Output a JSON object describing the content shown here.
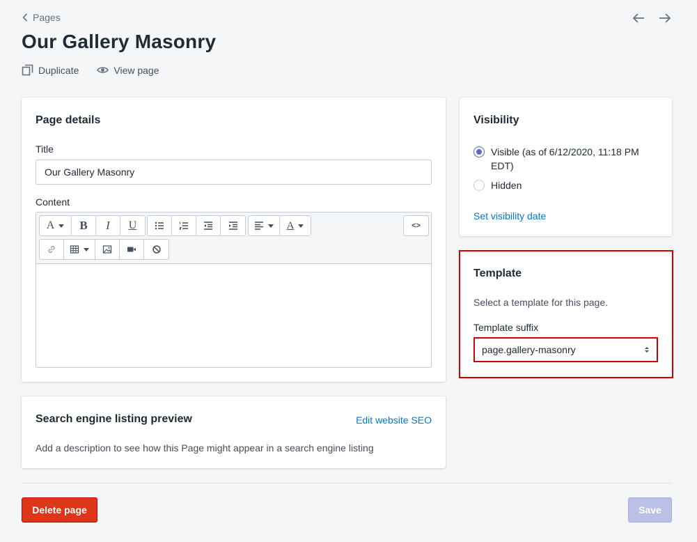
{
  "header": {
    "breadcrumb": "Pages",
    "title": "Our Gallery Masonry",
    "actions": {
      "duplicate": "Duplicate",
      "view_page": "View page"
    }
  },
  "page_details": {
    "heading": "Page details",
    "title_label": "Title",
    "title_value": "Our Gallery Masonry",
    "content_label": "Content",
    "toolbar": {
      "font": "A",
      "bold": "B",
      "italic": "I",
      "underline": "U",
      "text_color": "A",
      "html": "<>"
    }
  },
  "seo": {
    "heading": "Search engine listing preview",
    "edit_link": "Edit website SEO",
    "description": "Add a description to see how this Page might appear in a search engine listing"
  },
  "visibility": {
    "heading": "Visibility",
    "options": [
      {
        "label": "Visible (as of 6/12/2020, 11:18 PM EDT)",
        "checked": true
      },
      {
        "label": "Hidden",
        "checked": false
      }
    ],
    "set_date_link": "Set visibility date"
  },
  "template": {
    "heading": "Template",
    "description": "Select a template for this page.",
    "suffix_label": "Template suffix",
    "suffix_value": "page.gallery-masonry",
    "highlight_color": "#d10000"
  },
  "footer": {
    "delete_label": "Delete page",
    "save_label": "Save"
  },
  "colors": {
    "accent": "#5c6ac4",
    "link": "#007ace",
    "danger": "#de3618",
    "disabled_primary": "#bac0e6"
  }
}
